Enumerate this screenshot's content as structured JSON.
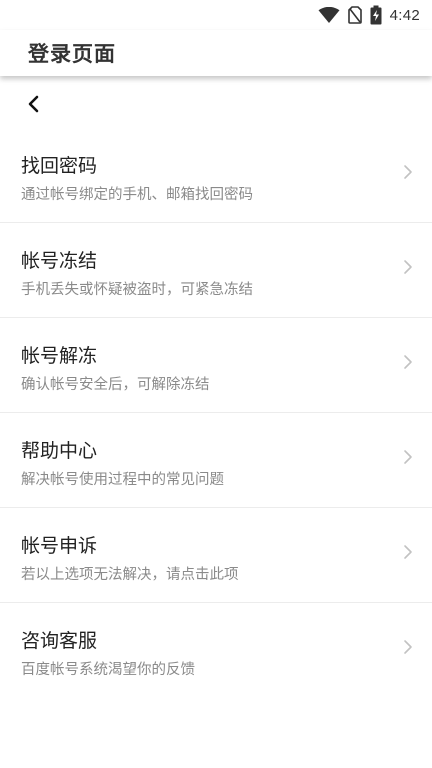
{
  "status_bar": {
    "time": "4:42",
    "icons": [
      "wifi-icon",
      "no-sim-icon",
      "battery-charging-icon"
    ]
  },
  "app_bar": {
    "title": "登录页面"
  },
  "nav": {
    "back_icon": "chevron-left-icon"
  },
  "menu": {
    "items": [
      {
        "title": "找回密码",
        "desc": "通过帐号绑定的手机、邮箱找回密码"
      },
      {
        "title": "帐号冻结",
        "desc": "手机丢失或怀疑被盗时，可紧急冻结"
      },
      {
        "title": "帐号解冻",
        "desc": "确认帐号安全后，可解除冻结"
      },
      {
        "title": "帮助中心",
        "desc": "解决帐号使用过程中的常见问题"
      },
      {
        "title": "帐号申诉",
        "desc": "若以上选项无法解决，请点击此项"
      },
      {
        "title": "咨询客服",
        "desc": "百度帐号系统渴望你的反馈"
      }
    ]
  },
  "colors": {
    "title_text": "#222222",
    "desc_text": "#8a8a8a",
    "divider": "#ececec",
    "chevron": "#c2c2c2"
  }
}
